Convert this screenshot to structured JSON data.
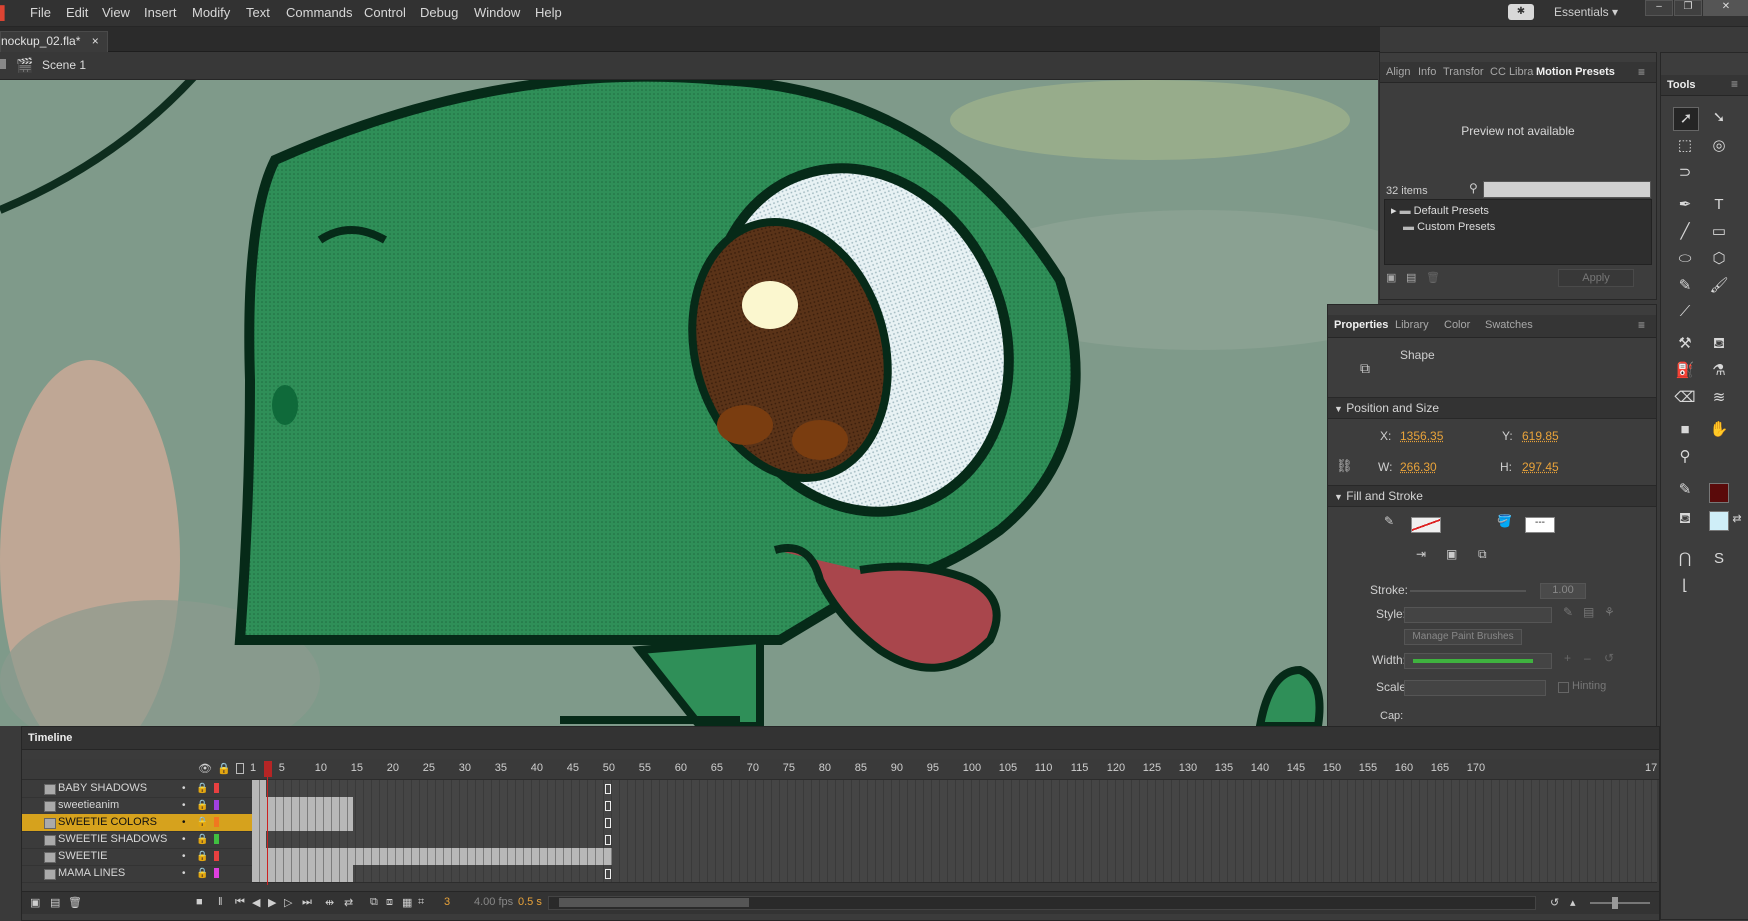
{
  "menu": [
    "File",
    "Edit",
    "View",
    "Insert",
    "Modify",
    "Text",
    "Commands",
    "Control",
    "Debug",
    "Window",
    "Help"
  ],
  "workspace": "Essentials",
  "document": {
    "tab_label": "nockup_02.fla*",
    "close": "×"
  },
  "scene": {
    "label": "Scene 1"
  },
  "presets_panel": {
    "tabs": [
      "Align",
      "Info",
      "Transfor",
      "CC Libra",
      "Motion Presets"
    ],
    "active_tab": "Motion Presets",
    "preview_text": "Preview not available",
    "item_count": "32 items",
    "folders": [
      "Default Presets",
      "Custom Presets"
    ],
    "apply_label": "Apply"
  },
  "properties_panel": {
    "tabs": [
      "Properties",
      "Library",
      "Color",
      "Swatches"
    ],
    "active_tab": "Properties",
    "object_type": "Shape",
    "position_size": {
      "title": "Position and Size",
      "x_label": "X:",
      "x": "1356.35",
      "y_label": "Y:",
      "y": "619.85",
      "w_label": "W:",
      "w": "266.30",
      "h_label": "H:",
      "h": "297.45"
    },
    "fill_stroke": {
      "title": "Fill and Stroke",
      "stroke_label": "Stroke:",
      "stroke_value": "1.00",
      "style_label": "Style:",
      "manage_brushes": "Manage Paint Brushes",
      "width_label": "Width:",
      "scale_label": "Scale:",
      "hinting_label": "Hinting",
      "cap_label": "Cap:"
    }
  },
  "tools_panel": {
    "title": "Tools"
  },
  "timeline": {
    "title": "Timeline",
    "layers": [
      {
        "name": "BABY SHADOWS",
        "color": "#e84040"
      },
      {
        "name": "sweetieanim",
        "color": "#a040e0"
      },
      {
        "name": "SWEETIE COLORS",
        "color": "#f07820",
        "selected": true
      },
      {
        "name": "SWEETIE SHADOWS",
        "color": "#40c040"
      },
      {
        "name": "SWEETIE",
        "color": "#e84040"
      },
      {
        "name": "MAMA LINES",
        "color": "#e040e0"
      }
    ],
    "ruler": [
      "1",
      "5",
      "10",
      "15",
      "20",
      "25",
      "30",
      "35",
      "40",
      "45",
      "50",
      "55",
      "60",
      "65",
      "70",
      "75",
      "80",
      "85",
      "90",
      "95",
      "100",
      "105",
      "110",
      "115",
      "120",
      "125",
      "130",
      "135",
      "140",
      "145",
      "150",
      "155",
      "160",
      "165",
      "170",
      "17"
    ],
    "current_frame": "3",
    "fps": "4.00 fps",
    "time": "0.5 s"
  },
  "colors": {
    "stroke_color": "#5a0a0a",
    "fill_color": "#cfeef8",
    "accent": "#e9a33a",
    "frame_marker": "#cc2222"
  }
}
